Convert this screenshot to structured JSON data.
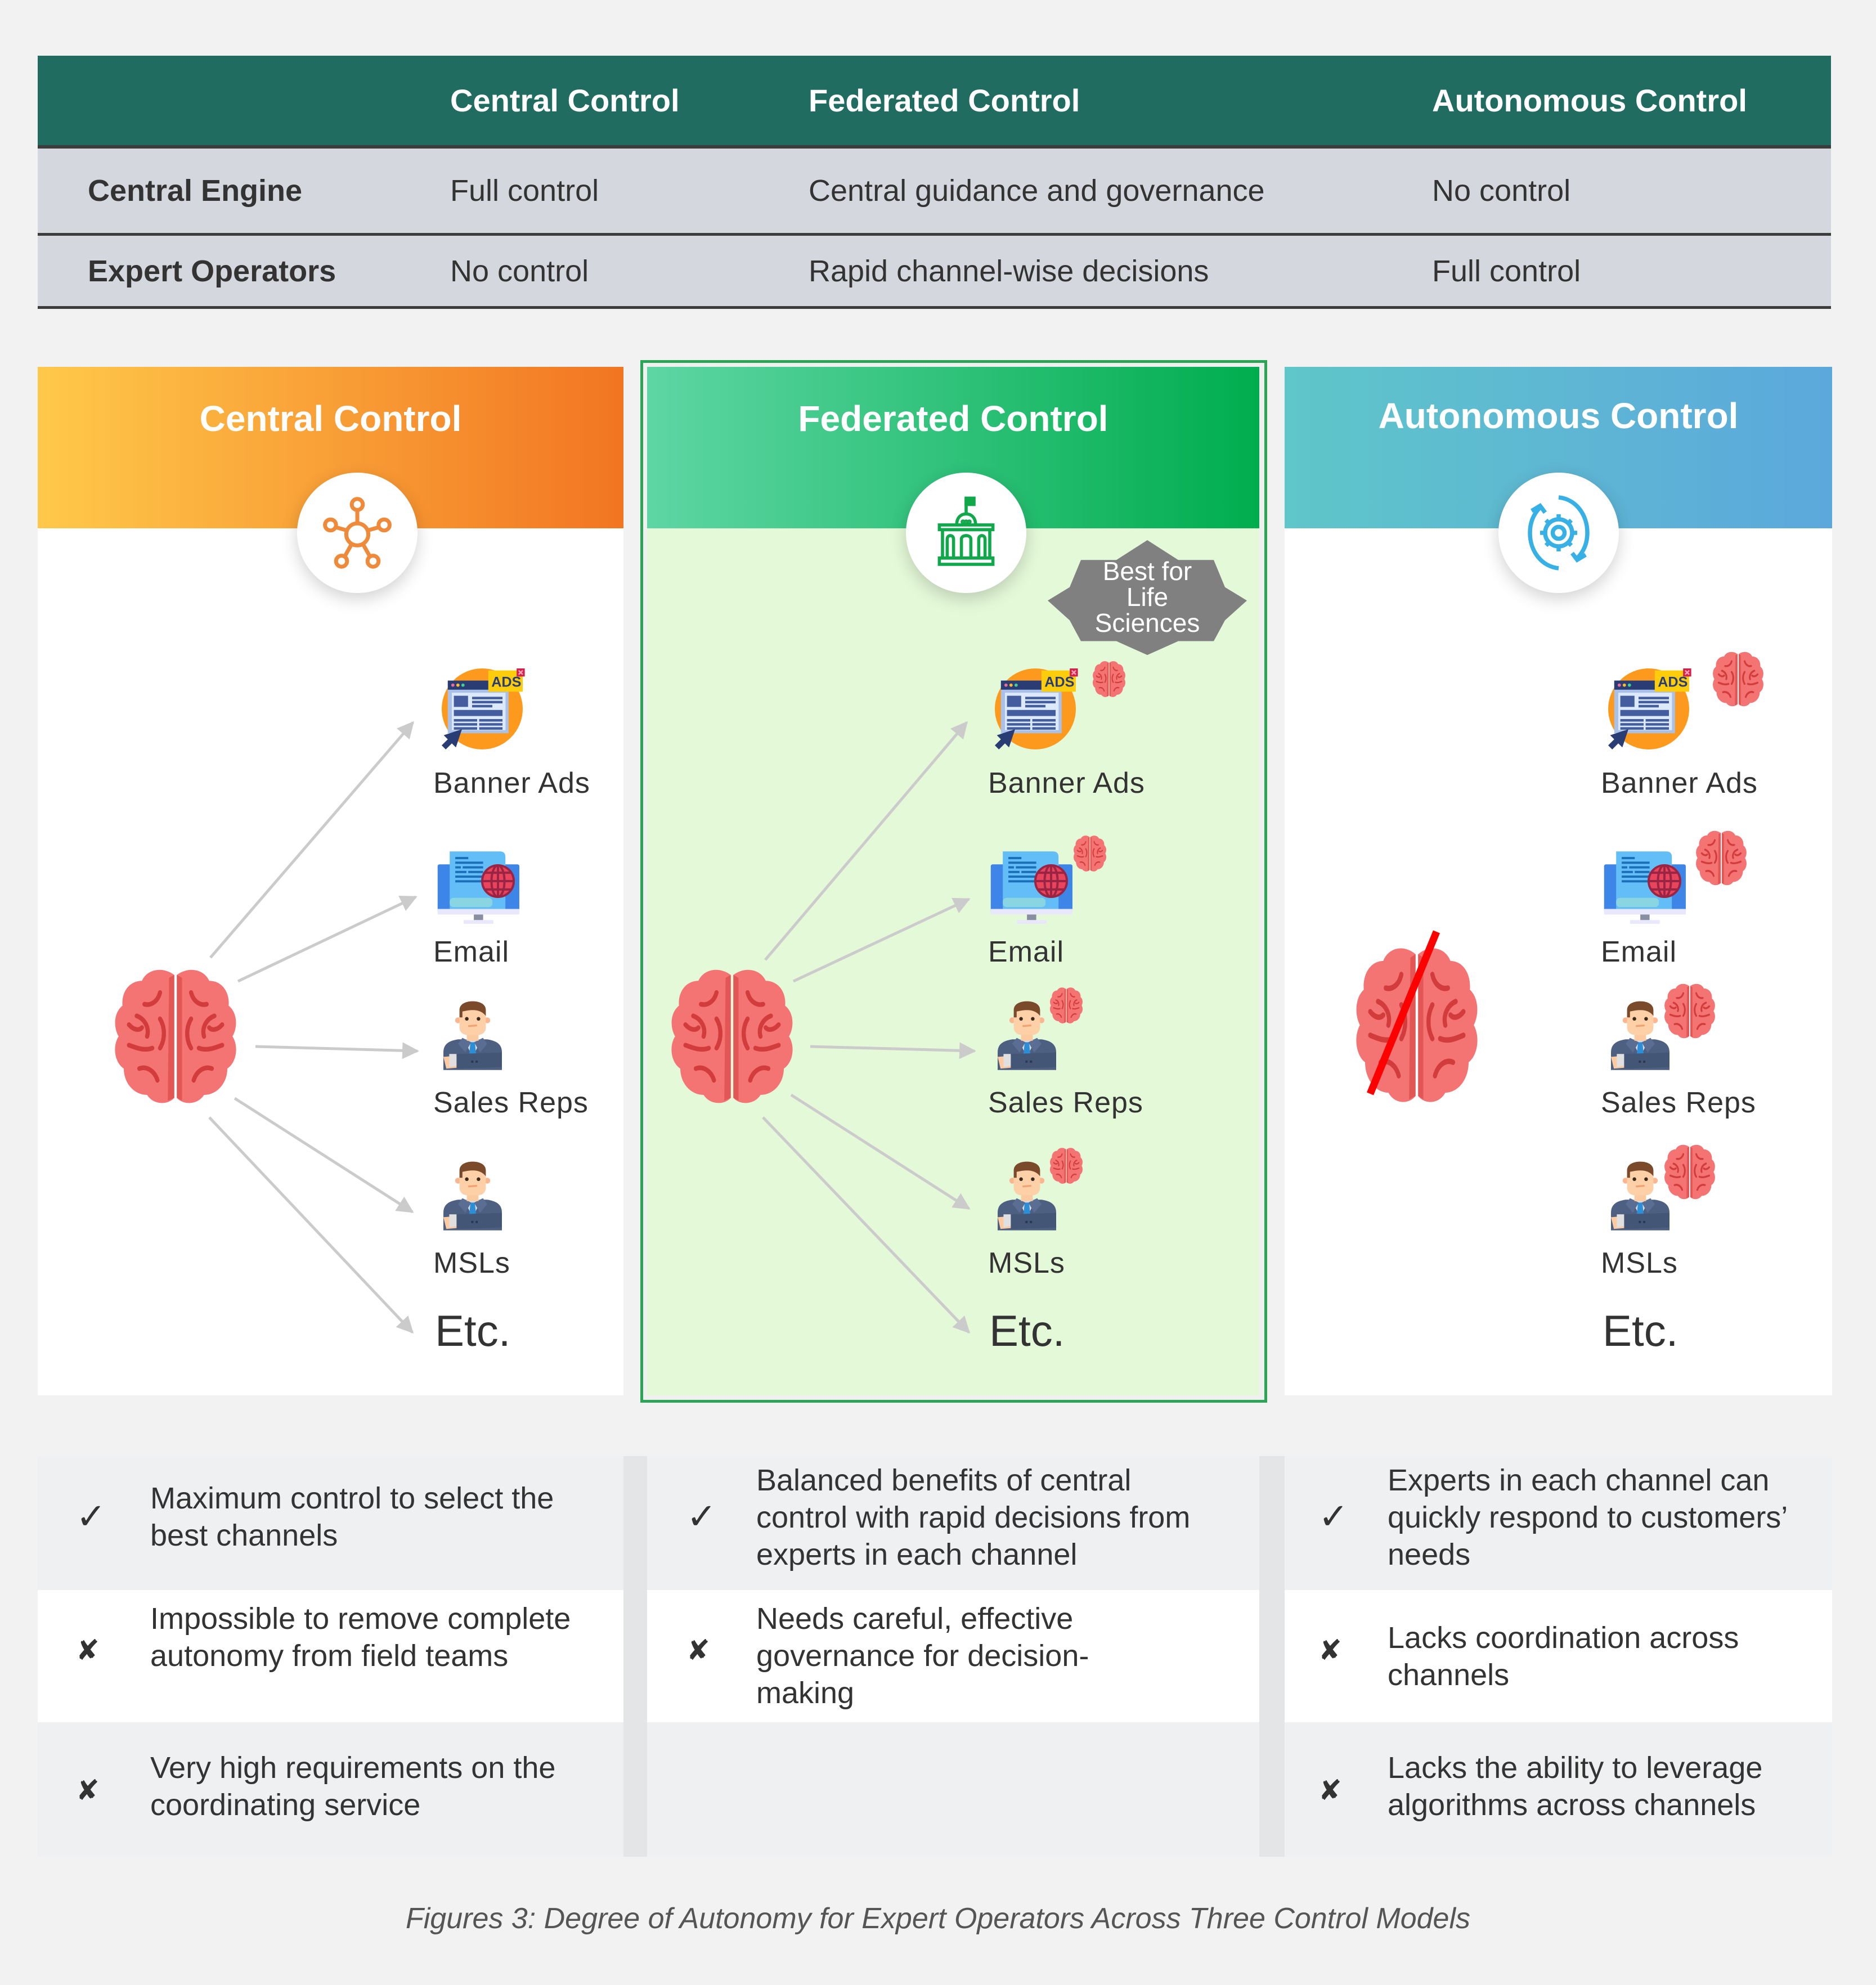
{
  "table": {
    "columns": [
      "",
      "Central Control",
      "Federated Control",
      "Autonomous Control"
    ],
    "rows": [
      {
        "label": "Central Engine",
        "cells": [
          "Full control",
          "Central guidance and governance",
          "No control"
        ]
      },
      {
        "label": "Expert Operators",
        "cells": [
          "No control",
          "Rapid channel-wise decisions",
          "Full control"
        ]
      }
    ]
  },
  "models": [
    {
      "title": "Central Control",
      "icon": "network-hub-icon",
      "accent": "#ef8a3a",
      "gradient": [
        "#ffc94a",
        "#f27522"
      ],
      "channels": [
        "Banner Ads",
        "Email",
        "Sales Reps",
        "MSLs"
      ],
      "etc": "Etc.",
      "channel_brains": false,
      "central_brain": "active"
    },
    {
      "title": "Federated Control",
      "icon": "government-building-icon",
      "accent": "#11a84c",
      "gradient": [
        "#5ed6a4",
        "#00ad4e"
      ],
      "highlight_bg": "#e4f9d8",
      "highlight_border": "#2aa455",
      "badge": "Best for Life Sciences",
      "badge_lines": [
        "Best for",
        "Life",
        "Sciences"
      ],
      "badge_color": "#808080",
      "channels": [
        "Banner Ads",
        "Email",
        "Sales Reps",
        "MSLs"
      ],
      "etc": "Etc.",
      "channel_brains": true,
      "central_brain": "active"
    },
    {
      "title": "Autonomous Control",
      "icon": "gear-cycle-icon",
      "accent": "#37b0e6",
      "gradient": [
        "#5fc6c9",
        "#5ca8dd"
      ],
      "channels": [
        "Banner Ads",
        "Email",
        "Sales Reps",
        "MSLs"
      ],
      "etc": "Etc.",
      "channel_brains": true,
      "central_brain": "crossed-out"
    }
  ],
  "pros_cons": [
    [
      {
        "type": "pro",
        "mark": "✓",
        "text": "Maximum control to select the best channels"
      },
      {
        "type": "con",
        "mark": "✘",
        "text": "Impossible to remove complete autonomy from field teams"
      },
      {
        "type": "con",
        "mark": "✘",
        "text": "Very high requirements on the coordinating service"
      }
    ],
    [
      {
        "type": "pro",
        "mark": "✓",
        "text": "Balanced benefits of central control with rapid decisions from experts in each channel"
      },
      {
        "type": "con",
        "mark": "✘",
        "text": "Needs careful, effective governance for decision-making"
      },
      {
        "type": "empty",
        "mark": "",
        "text": ""
      }
    ],
    [
      {
        "type": "pro",
        "mark": "✓",
        "text": "Experts in each channel can quickly respond to customers’ needs"
      },
      {
        "type": "con",
        "mark": "✘",
        "text": "Lacks coordination across channels"
      },
      {
        "type": "con",
        "mark": "✘",
        "text": "Lacks the ability to leverage algorithms across channels"
      }
    ]
  ],
  "caption": "Figures 3: Degree of Autonomy for Expert Operators Across Three Control Models"
}
